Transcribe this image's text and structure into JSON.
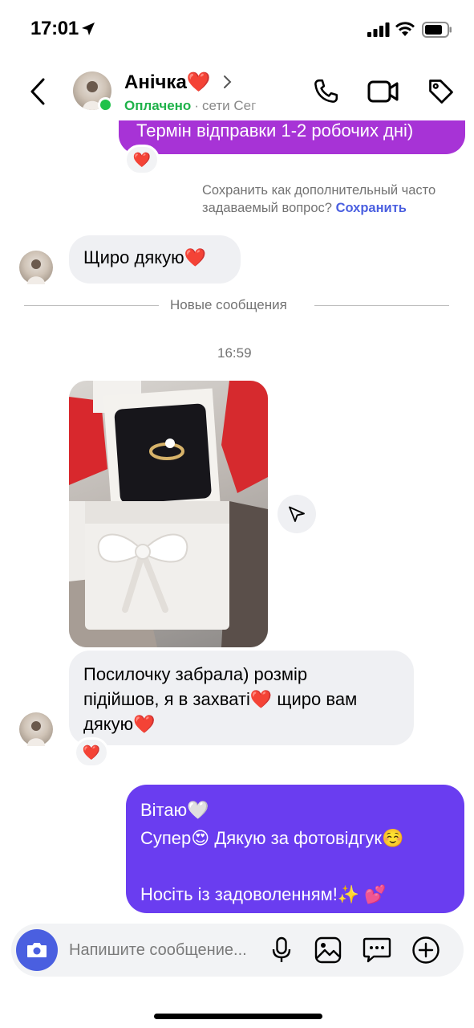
{
  "status_bar": {
    "time": "17:01"
  },
  "header": {
    "contact_name": "Анічка❤️",
    "status_paid": "Оплачено",
    "status_dot": "·",
    "status_text": "сети    Сег"
  },
  "messages": {
    "outgoing_top": "Термін відправки 1-2 робочих дні)",
    "reaction_heart": "❤️",
    "faq_prompt": "Сохранить как дополнительный часто задаваемый вопрос?",
    "faq_save": "Сохранить",
    "incoming_thanks": "Щиро дякую❤️",
    "divider_new": "Новые сообщения",
    "timestamp": "16:59",
    "incoming_photo_caption_lines": [
      "Посилочку забрала) розмір",
      "підійшов, я в захваті❤️  щиро вам",
      "дякую❤️"
    ],
    "outgoing_reply_lines": [
      "Вітаю🤍",
      "Супер😍 Дякую за фотовідгук☺️",
      "",
      "Носіть із задоволенням!✨ 💕"
    ]
  },
  "composer": {
    "placeholder": "Напишите сообщение..."
  },
  "colors": {
    "accent_blue": "#4a5fe0",
    "outgoing_purple": "#6a3df0",
    "outgoing_violet": "#a733d6",
    "online_green": "#1fc24a"
  }
}
